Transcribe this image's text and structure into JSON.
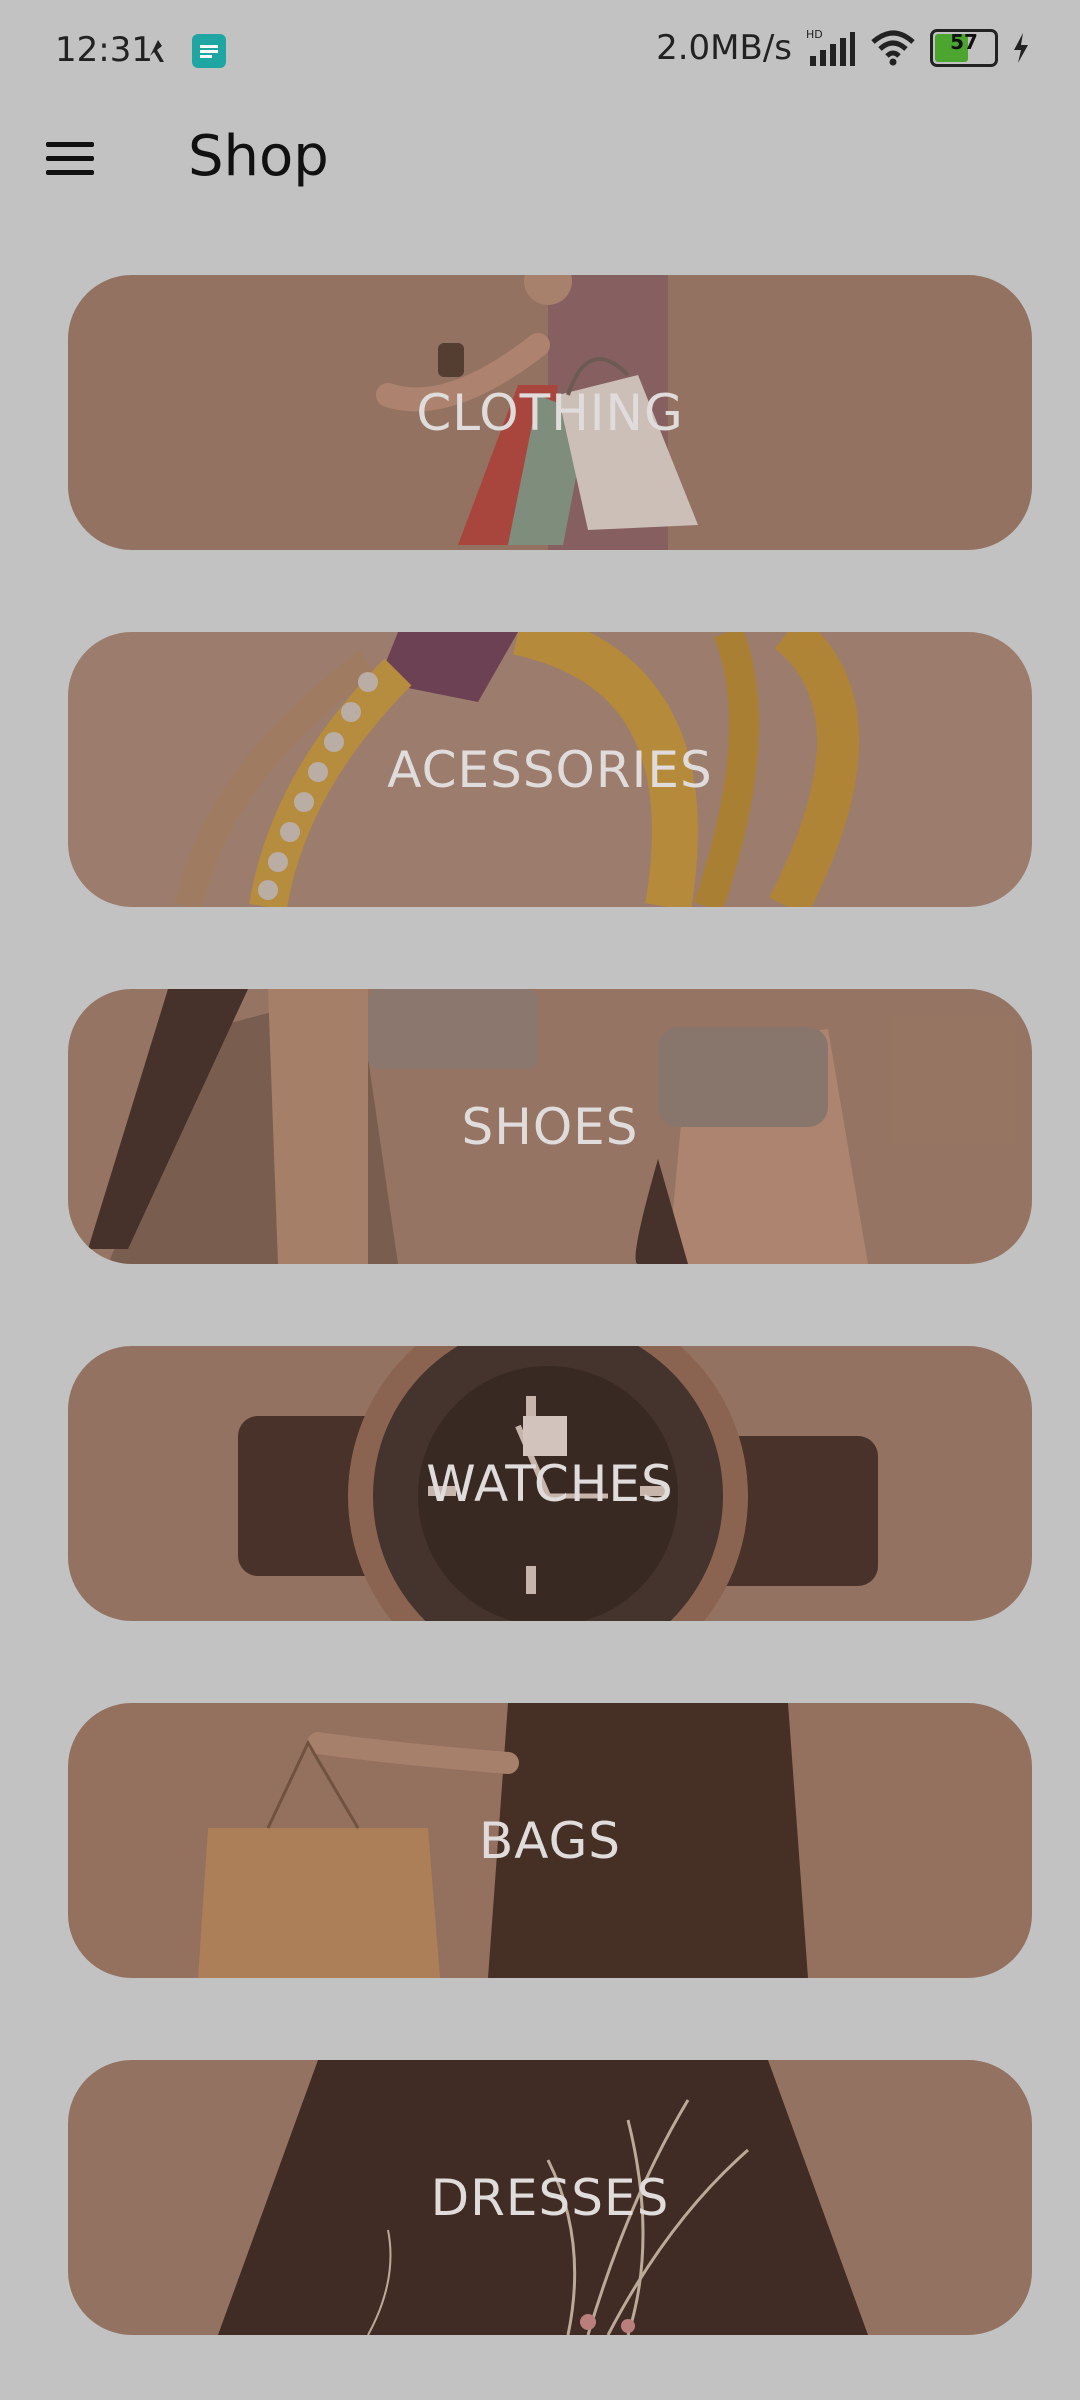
{
  "status_bar": {
    "time": "12:31",
    "speed": "2.0MB/s",
    "battery": "57",
    "battery_level": 0.57,
    "network_label": "HD"
  },
  "app_bar": {
    "title": "Shop",
    "menu_icon": "hamburger-menu-icon"
  },
  "categories": [
    {
      "label": "CLOTHING",
      "card_color": "#9a7a6a"
    },
    {
      "label": "ACESSORIES",
      "card_color": "#a48777"
    },
    {
      "label": "SHOES",
      "card_color": "#9c7d6c"
    },
    {
      "label": "WATCHES",
      "card_color": "#9a7a6a"
    },
    {
      "label": "BAGS",
      "card_color": "#9a7866"
    },
    {
      "label": "DRESSES",
      "card_color": "#9a7a6a"
    }
  ],
  "colors": {
    "background": "#c2c2c2",
    "label_text": "#e0dcdb",
    "status_icon": "#1fa6a3",
    "battery_green": "#4ca52e"
  }
}
